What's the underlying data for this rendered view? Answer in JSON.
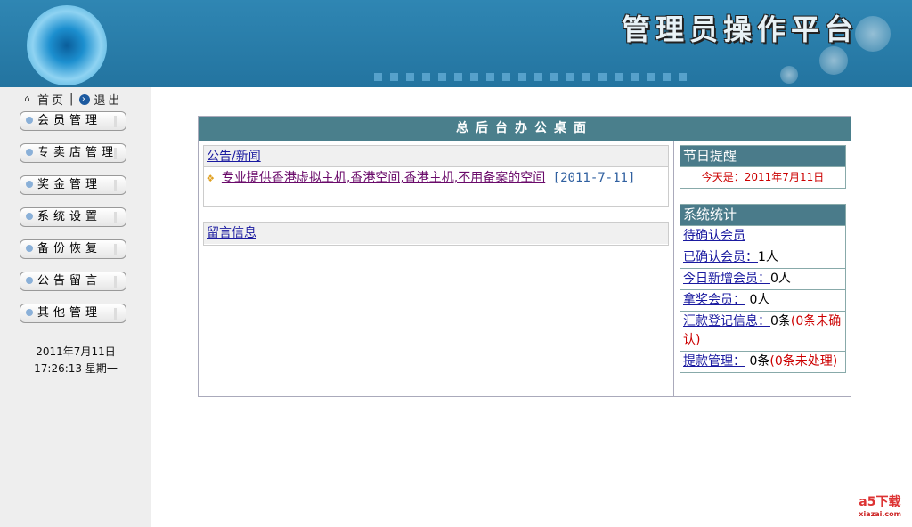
{
  "header": {
    "title": "管理员操作平台"
  },
  "toplinks": {
    "home": "首页",
    "sep": "|",
    "logout": "退出"
  },
  "menu": [
    "会员管理",
    "专卖店管理",
    "奖金管理",
    "系统设置",
    "备份恢复",
    "公告留言",
    "其他管理"
  ],
  "clock": {
    "date": "2011年7月11日",
    "time": "17:26:13 星期一"
  },
  "main": {
    "title": "总后台办公桌面",
    "news": {
      "header": "公告/新闻",
      "items": [
        {
          "title": "专业提供香港虚拟主机,香港空间,香港主机,不用备案的空间",
          "date": "[2011-7-11]"
        }
      ]
    },
    "messages": {
      "header": "留言信息"
    },
    "reminder": {
      "header": "节日提醒",
      "text": "今天是：2011年7月11日"
    },
    "stats": {
      "header": "系统统计",
      "rows": [
        {
          "link": "待确认会员",
          "value": "",
          "extra": ""
        },
        {
          "link": "已确认会员：",
          "value": "1人",
          "extra": ""
        },
        {
          "link": "今日新增会员：",
          "value": "0人",
          "extra": ""
        },
        {
          "link": "拿奖会员：",
          "value": " 0人",
          "extra": ""
        },
        {
          "link": "汇款登记信息：",
          "value": "0条",
          "extra": "(0条未确认)"
        },
        {
          "link": "提款管理：",
          "value": " 0条",
          "extra": "(0条未处理)"
        }
      ]
    }
  },
  "watermark": {
    "brand": "a5下载",
    "site": "xiazai.com"
  }
}
